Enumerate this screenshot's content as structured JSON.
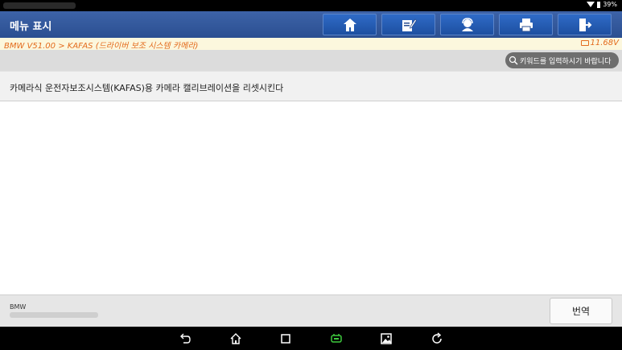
{
  "status": {
    "battery": "39%"
  },
  "header": {
    "title": "메뉴 표시",
    "buttons": [
      {
        "icon": "home-icon"
      },
      {
        "icon": "edit-icon"
      },
      {
        "icon": "support-icon"
      },
      {
        "icon": "printer-icon"
      },
      {
        "icon": "exit-icon"
      }
    ]
  },
  "breadcrumb": {
    "path": "BMW V51.00 > KAFAS (드라이버 보조 시스템 카메라)",
    "voltage": "11.68V"
  },
  "search": {
    "placeholder": "키워드를 입력하시기 바랍니다"
  },
  "items": [
    {
      "label": "카메라식 운전자보조시스템(KAFAS)용 카메라 캘리브레이션을 리셋시킨다"
    }
  ],
  "footer": {
    "brand": "BMW",
    "translate_label": "번역"
  },
  "colors": {
    "header": "#2b4f91",
    "accent": "#e36b1d",
    "nav_active": "#3ec93e"
  }
}
